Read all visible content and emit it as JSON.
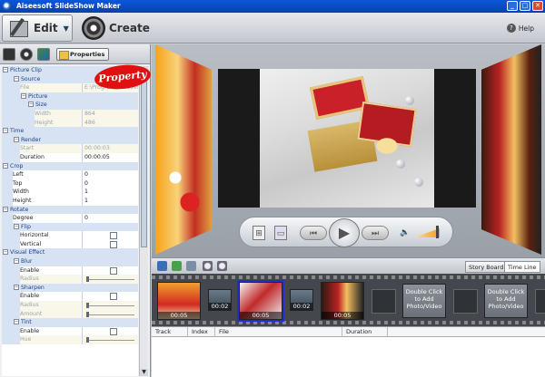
{
  "window": {
    "title": "Aiseesoft SlideShow Maker"
  },
  "toolbar": {
    "edit_label": "Edit",
    "create_label": "Create",
    "help_label": "Help"
  },
  "left_panel": {
    "properties_tab_label": "Properties",
    "property_badge": "Property"
  },
  "tree": {
    "picture_clip": "Picture Clip",
    "source": "Source",
    "file_key": "File",
    "file_value": "E:\\Program Files\\Aiseeso",
    "picture": "Picture",
    "size": "Size",
    "width_key": "Width",
    "width_value": "864",
    "height_key": "Height",
    "height_value": "486",
    "time": "Time",
    "render": "Render",
    "start_key": "Start",
    "start_value": "00:00:03",
    "duration_key": "Duration",
    "duration_value": "00:00:05",
    "crop": "Crop",
    "left_key": "Left",
    "left_value": "0",
    "top_key": "Top",
    "top_value": "0",
    "crop_width_key": "Width",
    "crop_width_value": "1",
    "crop_height_key": "Height",
    "crop_height_value": "1",
    "rotate": "Rotate",
    "degree_key": "Degree",
    "degree_value": "0",
    "flip": "Flip",
    "horizontal_key": "Horizontal",
    "vertical_key": "Vertical",
    "visual_effect": "Visual Effect",
    "blur": "Blur",
    "blur_enable": "Enable",
    "blur_radius": "Radius",
    "sharpen": "Sharpen",
    "sharpen_enable": "Enable",
    "sharpen_radius": "Radius",
    "sharpen_amount": "Amount",
    "tint": "Tint",
    "tint_enable": "Enable",
    "tint_hue": "Hue"
  },
  "timeline": {
    "story_board_tab": "Story Board",
    "time_line_tab": "Time Line",
    "thumbs": [
      {
        "caption": "00:05"
      },
      {
        "caption": "00:02"
      },
      {
        "caption": "00:05"
      },
      {
        "caption": "00:02"
      },
      {
        "caption": "00:05"
      }
    ],
    "add_placeholder": "Double Click to Add Photo/Video"
  },
  "track_table": {
    "columns": [
      "Track",
      "Index",
      "File",
      "Duration"
    ]
  }
}
